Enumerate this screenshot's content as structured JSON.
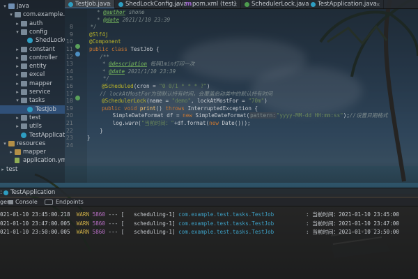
{
  "tree": {
    "items": [
      {
        "label": "java",
        "depth": 0,
        "expanded": true,
        "icon": "folder-icon",
        "icon_color": "blue"
      },
      {
        "label": "com.example.test",
        "depth": 1,
        "expanded": true,
        "icon": "package-icon"
      },
      {
        "label": "auth",
        "depth": 2,
        "expanded": false,
        "icon": "package-icon"
      },
      {
        "label": "config",
        "depth": 2,
        "expanded": true,
        "icon": "package-icon"
      },
      {
        "label": "ShedLockConfig",
        "depth": 3,
        "icon": "java-class-icon"
      },
      {
        "label": "constant",
        "depth": 2,
        "expanded": false,
        "icon": "package-icon"
      },
      {
        "label": "controller",
        "depth": 2,
        "expanded": false,
        "icon": "package-icon"
      },
      {
        "label": "entity",
        "depth": 2,
        "expanded": false,
        "icon": "package-icon"
      },
      {
        "label": "excel",
        "depth": 2,
        "expanded": false,
        "icon": "package-icon"
      },
      {
        "label": "mapper",
        "depth": 2,
        "expanded": false,
        "icon": "package-icon"
      },
      {
        "label": "service",
        "depth": 2,
        "expanded": false,
        "icon": "package-icon"
      },
      {
        "label": "tasks",
        "depth": 2,
        "expanded": true,
        "icon": "package-icon"
      },
      {
        "label": "TestJob",
        "depth": 3,
        "selected": true,
        "icon": "java-class-icon"
      },
      {
        "label": "test",
        "depth": 2,
        "expanded": false,
        "icon": "package-icon"
      },
      {
        "label": "utils",
        "depth": 2,
        "expanded": false,
        "icon": "package-icon"
      },
      {
        "label": "TestApplication",
        "depth": 2,
        "icon": "java-class-icon"
      },
      {
        "label": "resources",
        "depth": 0,
        "expanded": true,
        "icon": "folder-icon",
        "icon_color": "yellow"
      },
      {
        "label": "mapper",
        "depth": 1,
        "expanded": false,
        "icon": "folder-icon",
        "icon_color": "yellow"
      },
      {
        "label": "application.yml",
        "depth": 1,
        "icon": "yml-file-icon"
      },
      {
        "label": "test",
        "depth": -1,
        "expanded": false,
        "icon": "none"
      }
    ]
  },
  "tabs": [
    {
      "label": "TestJob.java",
      "active": true,
      "icon": "java-class-icon"
    },
    {
      "label": "ShedLockConfig.java",
      "active": false,
      "icon": "java-class-icon"
    },
    {
      "label": "pom.xml (test)",
      "active": false,
      "icon": "maven-icon"
    },
    {
      "label": "SchedulerLock.java",
      "active": false,
      "icon": "java-annotation-icon"
    },
    {
      "label": "TestApplication.java",
      "active": false,
      "icon": "java-class-icon"
    }
  ],
  "editor": {
    "line_numbers": [
      "",
      "",
      "",
      "",
      "",
      "",
      "",
      "",
      "",
      "",
      "",
      "",
      "",
      "",
      "",
      "",
      "",
      "",
      "",
      "",
      "",
      "",
      "",
      ""
    ],
    "visible_line_numbers": [
      "8",
      "9",
      "10",
      "11",
      "12",
      "13",
      "14",
      "15",
      "16",
      "17",
      "18",
      "19",
      "20",
      "21",
      "22",
      "23",
      "24"
    ],
    "lines": {
      "l1_tag": "@author",
      "l1_val": " shone",
      "l2_tag": "@date",
      "l2_val": " 2021/1/10 23:39",
      "l3": " */",
      "l4": "@Slf4j",
      "l5": "@Component",
      "l6_kw": "public class",
      "l6_name": " TestJob {",
      "l7": "    /**",
      "l8_tag": "@description",
      "l8_val": " 每隔1min打印一次",
      "l9_tag": "@date",
      "l9_val": " 2021/1/10 23:39",
      "l10": "     */",
      "l11_ann": "@Scheduled",
      "l11_a": "(cron = ",
      "l11_str": "\"0 0/1 * * * ?\"",
      "l11_b": ")",
      "l12": "    // lockAtMostFor为锁默认持有时间，会覆盖启动类中的默认持有时间",
      "l13_ann": "@SchedulerLock",
      "l13_a": "(name = ",
      "l13_str1": "\"demo\"",
      "l13_b": ", lockAtMostFor = ",
      "l13_str2": "\"70m\"",
      "l13_c": ")",
      "l14_kw1": "public void",
      "l14_fn": " print",
      "l14_a": "() ",
      "l14_kw2": "throws",
      "l14_exc": " InterruptedException {",
      "l15_a": "        SimpleDateFormat df = ",
      "l15_kw": "new",
      "l15_b": " SimpleDateFormat(",
      "l15_hint": "pattern:",
      "l15_str": "\"yyyy-MM-dd HH:mm:ss\"",
      "l15_c": ");",
      "l15_cm": "//设置日期格式",
      "l16_a": "        log.",
      "l16_fn": "warn",
      "l16_b": "(",
      "l16_str": "\"当前时间：\"",
      "l16_c": "+df.format(",
      "l16_kw": "new",
      "l16_d": " Date()));",
      "l17": "    }",
      "l18": "}"
    }
  },
  "run": {
    "label": "TestApplication",
    "toolbar": {
      "tab1": "ger",
      "tab2": "Console",
      "tab3": "Endpoints"
    },
    "log": [
      {
        "ts": "021-01-10 23:45:00.218",
        "level": "WARN",
        "pid": "5860",
        "sep": " --- [",
        "thread": "   scheduling-1]",
        "cls": "com.example.test.tasks.TestJob",
        "msg": "  : 当前时间：2021-01-10 23:45:00"
      },
      {
        "ts": "021-01-10 23:47:00.005",
        "level": "WARN",
        "pid": "5860",
        "sep": " --- [",
        "thread": "   scheduling-1]",
        "cls": "com.example.test.tasks.TestJob",
        "msg": "  : 当前时间：2021-01-10 23:47:00"
      },
      {
        "ts": "021-01-10 23:50:00.005",
        "level": "WARN",
        "pid": "5860",
        "sep": " --- [",
        "thread": "   scheduling-1]",
        "cls": "com.example.test.tasks.TestJob",
        "msg": "  : 当前时间：2021-01-10 23:50:00"
      }
    ]
  },
  "colors": {
    "keyword": "#cc7832",
    "annotation": "#bbb529",
    "string": "#6a8759",
    "comment": "#7f8c8d",
    "doc_tag": "#629755",
    "log_warn": "#ccac46",
    "log_pid": "#b86ec4",
    "log_class": "#3d9fc4",
    "selection": "#365c8c"
  }
}
